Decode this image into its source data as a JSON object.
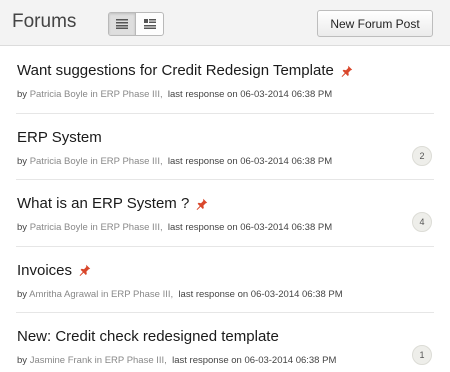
{
  "header": {
    "title": "Forums",
    "new_post_label": "New Forum Post",
    "view_icons": [
      "list-view-icon",
      "detail-view-icon"
    ]
  },
  "posts": [
    {
      "title": "Want suggestions for Credit Redesign Template",
      "pinned": true,
      "author": "Patricia Boyle",
      "in_text": "in",
      "project": "ERP Phase III,",
      "last_response": "last response on 06-03-2014 06:38 PM",
      "replies": ""
    },
    {
      "title": "ERP System",
      "pinned": false,
      "author": "Patricia Boyle",
      "in_text": "in",
      "project": "ERP Phase III,",
      "last_response": "last response on 06-03-2014 06:38 PM",
      "replies": "2"
    },
    {
      "title": "What is an ERP System ?",
      "pinned": true,
      "author": "Patricia Boyle",
      "in_text": "in",
      "project": "ERP Phase III,",
      "last_response": "last response on 06-03-2014 06:38 PM",
      "replies": "4"
    },
    {
      "title": "Invoices",
      "pinned": true,
      "author": "Amritha Agrawal",
      "in_text": "in",
      "project": "ERP Phase III,",
      "last_response": "last response on 06-03-2014 06:38 PM",
      "replies": ""
    },
    {
      "title": "New: Credit check redesigned template",
      "pinned": false,
      "author": "Jasmine Frank",
      "in_text": "in",
      "project": "ERP Phase III,",
      "last_response": "last response on 06-03-2014 06:38 PM",
      "replies": "1"
    }
  ],
  "colors": {
    "pin": "#d9472b",
    "author": "#888888"
  }
}
